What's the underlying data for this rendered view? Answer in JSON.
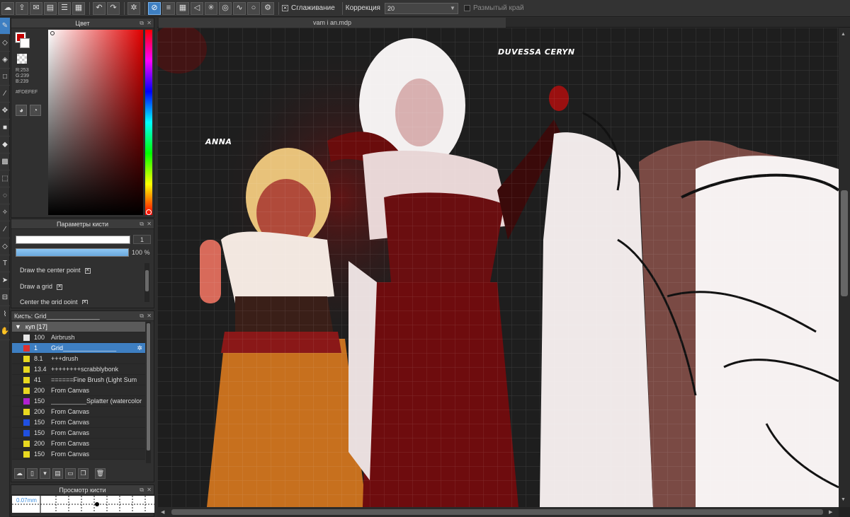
{
  "toolbar": {
    "smoothing_label": "Сглаживание",
    "correction_label": "Коррекция",
    "correction_value": "20",
    "soft_edge_label": "Размытый край"
  },
  "document": {
    "tab_title": "vam i an.mdp"
  },
  "color_panel": {
    "title": "Цвет",
    "r": "R:253",
    "g": "G:239",
    "b": "B:239",
    "hex": "#FDEFEF",
    "foreground": "#c40000",
    "background": "#ffffff"
  },
  "brush_params": {
    "title": "Параметры кисти",
    "size_value": "1",
    "opacity_value": "100 %",
    "options": [
      {
        "label": "Draw the center point",
        "checked": true
      },
      {
        "label": "Draw a grid",
        "checked": true
      },
      {
        "label": "Center the grid point",
        "checked": true
      }
    ]
  },
  "brush_panel": {
    "title": "Кисть: Grid_______________",
    "group": "куп [17]",
    "rows": [
      {
        "num": "100",
        "name": "Airbrush",
        "color": "#e6e6e6",
        "selected": false
      },
      {
        "num": "1",
        "name": "Grid_______________",
        "color": "#e03030",
        "selected": true
      },
      {
        "num": "8.1",
        "name": "+++drush",
        "color": "#e8d820",
        "selected": false
      },
      {
        "num": "13.4",
        "name": "++++++++scrabblybonk",
        "color": "#e8d820",
        "selected": false
      },
      {
        "num": "41",
        "name": "======Fine Brush (Light Sum",
        "color": "#e8d820",
        "selected": false
      },
      {
        "num": "200",
        "name": "From Canvas",
        "color": "#e8d820",
        "selected": false
      },
      {
        "num": "150",
        "name": "__________Splatter (watercolor",
        "color": "#b020d0",
        "selected": false
      },
      {
        "num": "200",
        "name": "From Canvas",
        "color": "#e8d820",
        "selected": false
      },
      {
        "num": "150",
        "name": "From Canvas",
        "color": "#2050e0",
        "selected": false
      },
      {
        "num": "150",
        "name": "From Canvas",
        "color": "#2050e0",
        "selected": false
      },
      {
        "num": "200",
        "name": "From Canvas",
        "color": "#e8d820",
        "selected": false
      },
      {
        "num": "150",
        "name": "From Canvas",
        "color": "#e8d820",
        "selected": false
      }
    ]
  },
  "brush_preview": {
    "title": "Просмотр кисти",
    "size_label": "0.07mm"
  },
  "artwork": {
    "label_left": "ANNA",
    "label_right": "DUVESSA CERYN"
  },
  "icons": [
    "cloud-icon",
    "share-icon",
    "chat-icon",
    "doc-icon",
    "list-icon",
    "grid-icon",
    "undo-icon",
    "redo-icon",
    "sparkle-icon",
    "snap-off-icon",
    "snap-parallel-icon",
    "snap-grid-icon",
    "snap-perspective-icon",
    "snap-radial-icon",
    "snap-concentric-icon",
    "snap-curve-icon",
    "snap-circle-icon",
    "snap-settings-icon"
  ]
}
